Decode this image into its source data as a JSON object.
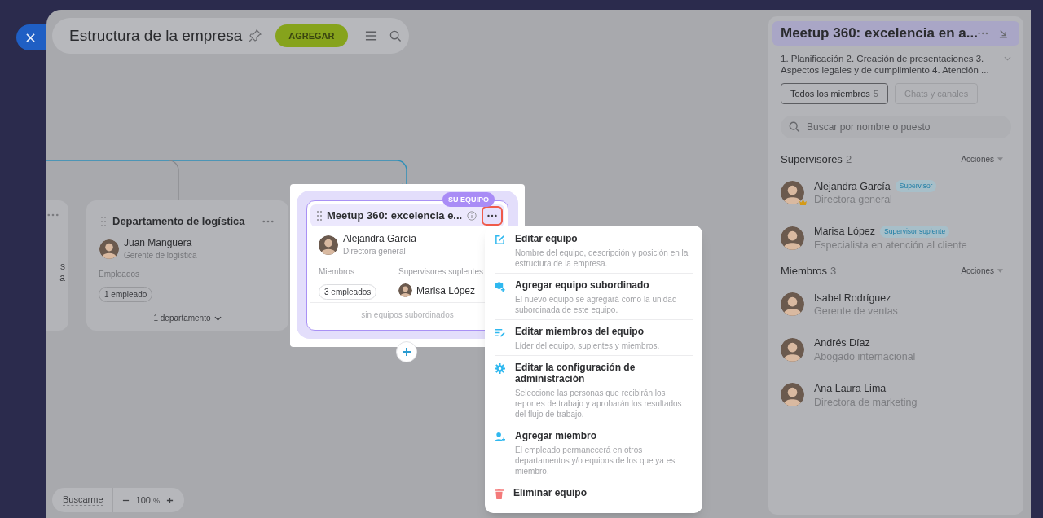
{
  "header": {
    "title": "Estructura de la empresa",
    "add_button": "AGREGAR"
  },
  "cut_card": {
    "texts": [
      "s",
      "a"
    ]
  },
  "department_card": {
    "title": "Departamento de logística",
    "head": {
      "name": "Juan Manguera",
      "role": "Gerente de logística"
    },
    "employees_label": "Empleados",
    "employees": "1 empleado",
    "subunits": "1 departamento"
  },
  "team_card": {
    "badge": "SU EQUIPO",
    "title": "Meetup 360: excelencia e...",
    "head": {
      "name": "Alejandra García",
      "role": "Directora general"
    },
    "members_label": "Miembros",
    "members": "3 empleados",
    "deputies_label": "Supervisores suplentes",
    "deputy": "Marisa López",
    "footer": "sin equipos subordinados"
  },
  "context_menu": [
    {
      "kind": "edit",
      "title": "Editar equipo",
      "description": "Nombre del equipo, descripción y posición en la estructura de la empresa."
    },
    {
      "kind": "subteam",
      "title": "Agregar equipo subordinado",
      "description": "El nuevo equipo se agregará como la unidad subordinada de este equipo."
    },
    {
      "kind": "members",
      "title": "Editar miembros del equipo",
      "description": "Líder del equipo, suplentes y miembros."
    },
    {
      "kind": "settings",
      "title": "Editar la configuración de administración",
      "description": "Seleccione las personas que recibirán los reportes de trabajo y aprobarán los resultados del flujo de trabajo."
    },
    {
      "kind": "add_member",
      "title": "Agregar miembro",
      "description": "El empleado permanecerá en otros departamentos y/o equipos de los que ya es miembro."
    },
    {
      "kind": "delete",
      "title": "Eliminar equipo"
    }
  ],
  "zoom_bar": {
    "find_me": "Buscarme",
    "value": "100",
    "unit": "%"
  },
  "side_panel": {
    "title": "Meetup 360: excelencia en a...",
    "description": "1. Planificación 2. Creación de presentaciones 3. Aspectos legales y de cumplimiento 4. Atención ...",
    "tabs": [
      {
        "label": "Todos los miembros",
        "count": "5",
        "selected": true
      },
      {
        "label": "Chats y canales",
        "selected": false
      }
    ],
    "search": {
      "placeholder": "Buscar por nombre o puesto"
    },
    "sections": [
      {
        "title": "Supervisores",
        "count": "2",
        "actions": "Acciones",
        "people": [
          {
            "name": "Alejandra García",
            "role": "Directora general",
            "badge": "Supervisor",
            "crown": true
          },
          {
            "name": "Marisa López",
            "role": "Especialista en atención al cliente",
            "badge": "Supervisor suplente",
            "crown": false
          }
        ]
      },
      {
        "title": "Miembros",
        "count": "3",
        "actions": "Acciones",
        "people": [
          {
            "name": "Isabel Rodríguez",
            "role": "Gerente de ventas",
            "crown": false
          },
          {
            "name": "Andrés Díaz",
            "role": "Abogado internacional",
            "crown": false
          },
          {
            "name": "Ana Laura Lima",
            "role": "Directora de marketing",
            "crown": false
          }
        ]
      }
    ]
  }
}
